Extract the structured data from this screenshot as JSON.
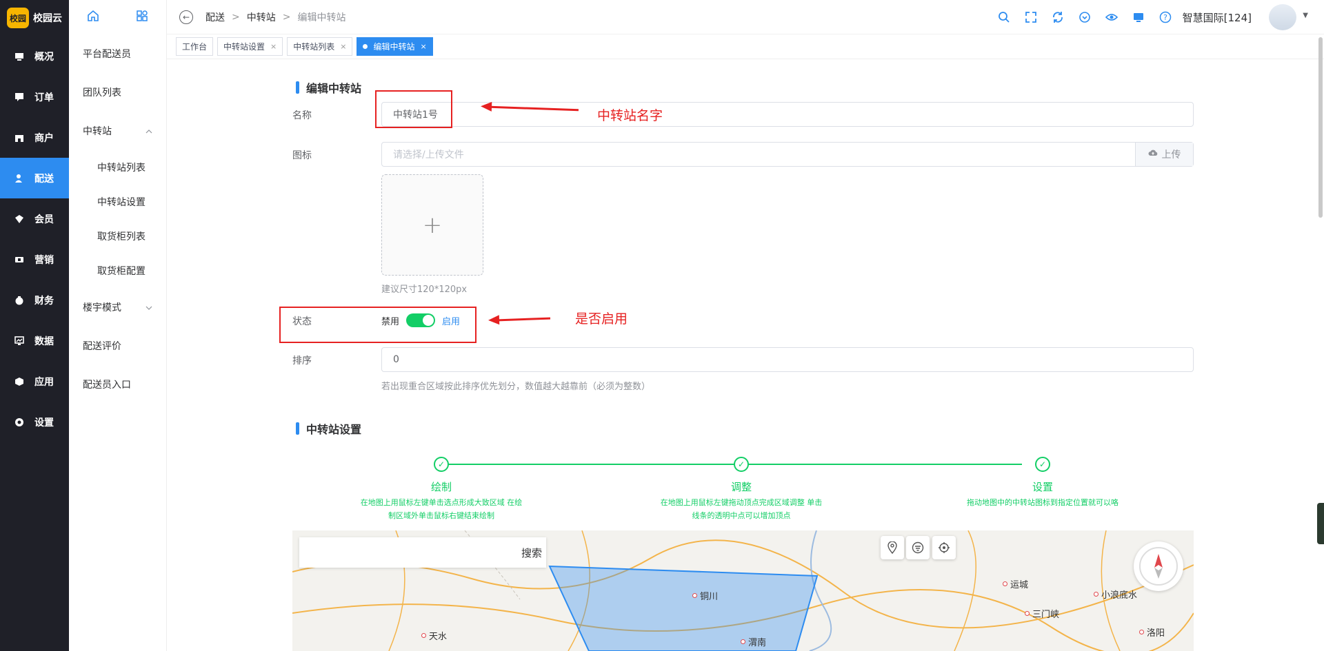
{
  "logo": {
    "mark": "校园",
    "text": "校园云"
  },
  "nav": [
    {
      "label": "概况",
      "icon": "dashboard-icon"
    },
    {
      "label": "订单",
      "icon": "order-icon"
    },
    {
      "label": "商户",
      "icon": "store-icon"
    },
    {
      "label": "配送",
      "icon": "delivery-icon",
      "active": true
    },
    {
      "label": "会员",
      "icon": "member-icon"
    },
    {
      "label": "营销",
      "icon": "marketing-icon"
    },
    {
      "label": "财务",
      "icon": "finance-icon"
    },
    {
      "label": "数据",
      "icon": "data-icon"
    },
    {
      "label": "应用",
      "icon": "app-icon"
    },
    {
      "label": "设置",
      "icon": "settings-icon"
    }
  ],
  "sub": {
    "items": [
      "平台配送员",
      "团队列表",
      "中转站",
      "楼宇模式",
      "配送评价",
      "配送员入口"
    ],
    "children": [
      "中转站列表",
      "中转站设置",
      "取货柜列表",
      "取货柜配置"
    ]
  },
  "breadcrumb": [
    "配送",
    "中转站",
    "编辑中转站"
  ],
  "user": {
    "name": "智慧国际[124]"
  },
  "tabs": [
    {
      "label": "工作台",
      "closable": false
    },
    {
      "label": "中转站设置",
      "closable": true
    },
    {
      "label": "中转站列表",
      "closable": true
    },
    {
      "label": "编辑中转站",
      "closable": true,
      "active": true
    }
  ],
  "form": {
    "title": "编辑中转站",
    "name_label": "名称",
    "name_value": "中转站1号",
    "icon_label": "图标",
    "icon_placeholder": "请选择/上传文件",
    "upload_label": "上传",
    "size_hint": "建议尺寸120*120px",
    "status_label": "状态",
    "status_off": "禁用",
    "status_on": "启用",
    "status_enabled": true,
    "sort_label": "排序",
    "sort_value": "0",
    "sort_hint": "若出现重合区域按此排序优先划分，数值越大越靠前（必须为整数）"
  },
  "annotations": {
    "name": "中转站名字",
    "status": "是否启用"
  },
  "settings": {
    "title": "中转站设置",
    "steps": [
      {
        "title": "绘制",
        "desc1": "在地图上用鼠标左键单击选点形成大致区域 在绘",
        "desc2": "制区域外单击鼠标右键结束绘制"
      },
      {
        "title": "调整",
        "desc1": "在地图上用鼠标左键拖动顶点完成区域调整 单击",
        "desc2": "线条的透明中点可以增加顶点"
      },
      {
        "title": "设置",
        "desc1": "拖动地图中的中转站图标到指定位置就可以咯",
        "desc2": ""
      }
    ]
  },
  "map": {
    "search_label": "搜索",
    "cities": [
      "铜川",
      "天水",
      "渭南",
      "运城",
      "三门峡",
      "小浪底水",
      "洛阳"
    ]
  }
}
